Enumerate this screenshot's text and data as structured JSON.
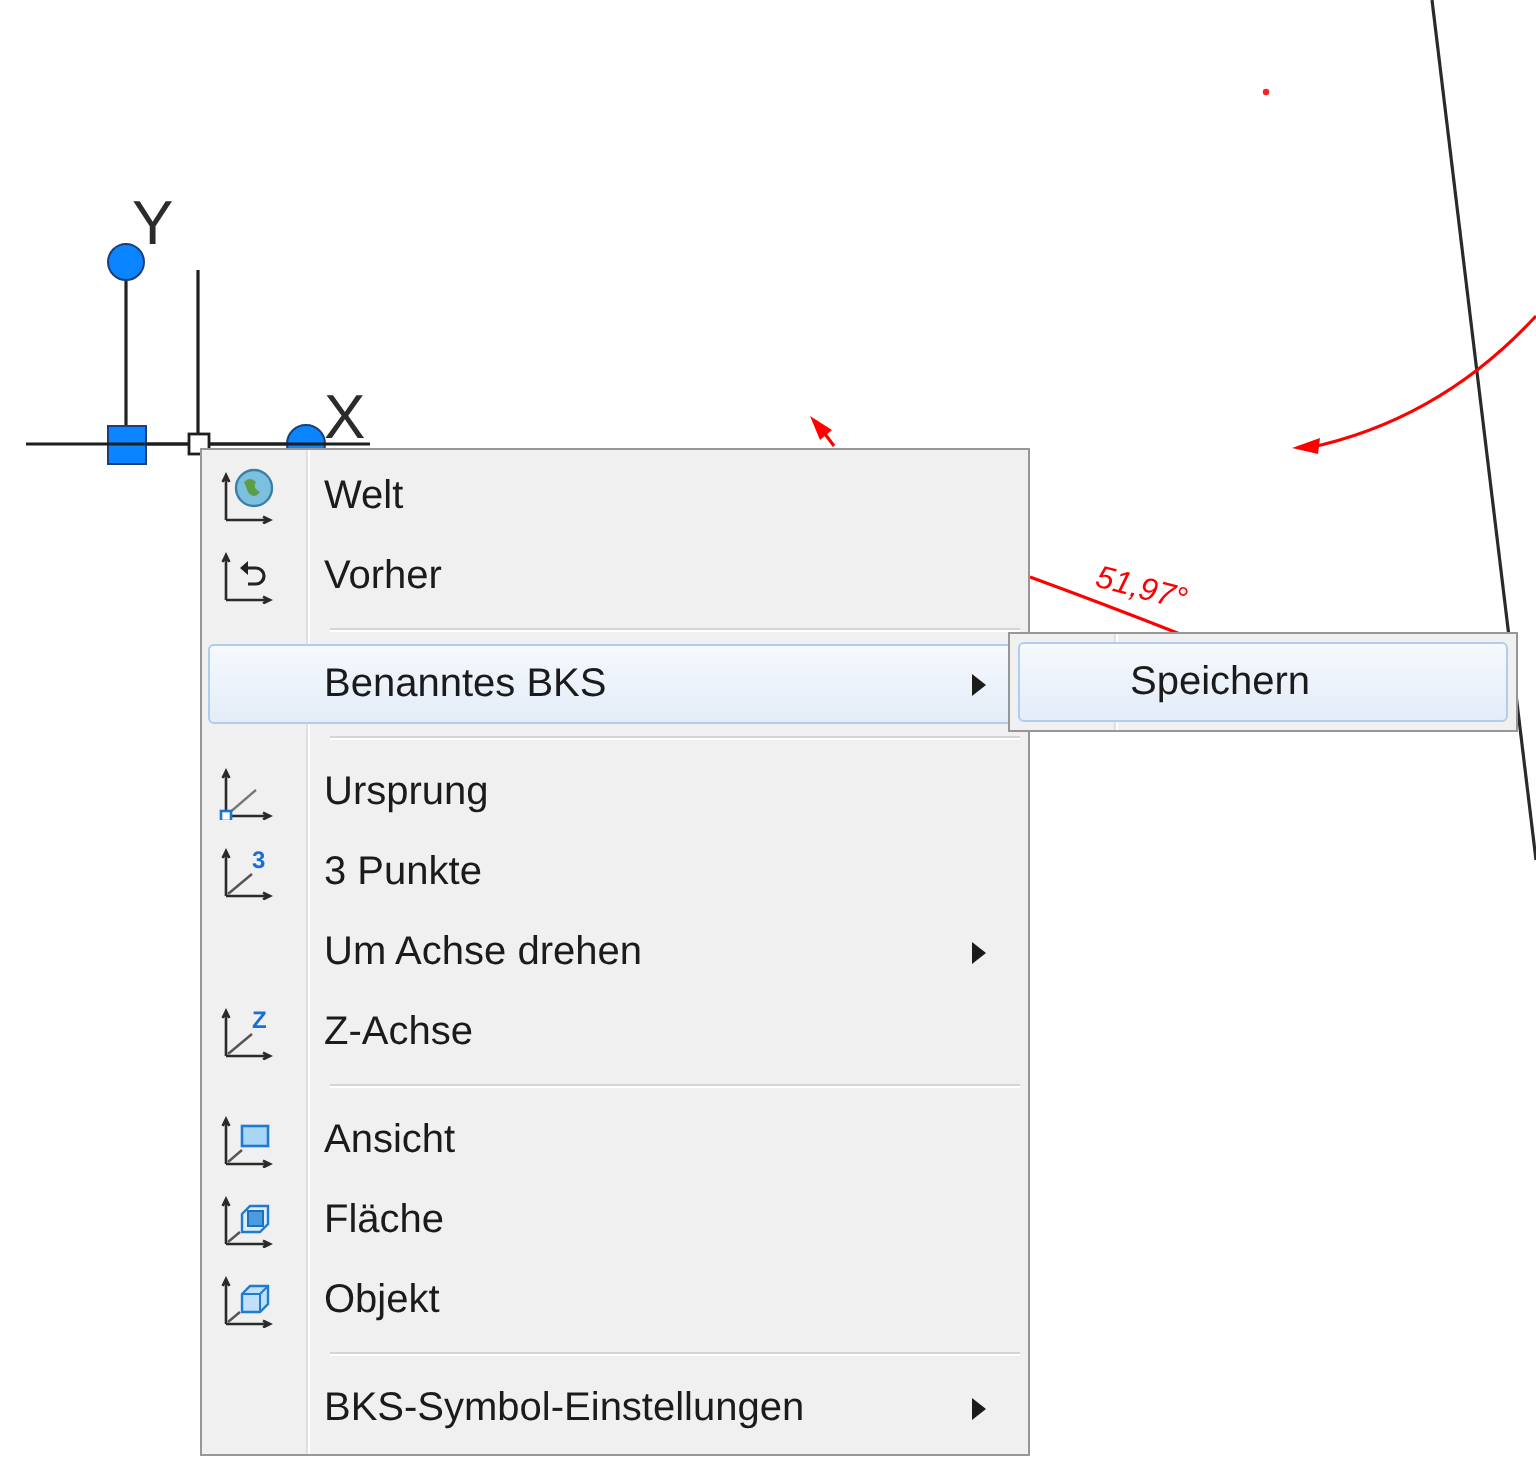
{
  "drawing": {
    "ucs_icon": {
      "y_label": "Y",
      "x_label": "X"
    },
    "dimension": {
      "text": "51,97°"
    }
  },
  "context_menu": {
    "entries": [
      {
        "kind": "command",
        "label": "Welt",
        "selected": false
      },
      {
        "kind": "command",
        "label": "Vorher",
        "selected": false
      },
      {
        "kind": "separator"
      },
      {
        "kind": "submenu",
        "label": "Benanntes BKS",
        "selected": true
      },
      {
        "kind": "separator"
      },
      {
        "kind": "command",
        "label": "Ursprung",
        "selected": false
      },
      {
        "kind": "command",
        "label": "3 Punkte",
        "icon_text": "3",
        "selected": false
      },
      {
        "kind": "submenu",
        "label": "Um Achse drehen",
        "selected": false
      },
      {
        "kind": "command",
        "label": "Z-Achse",
        "icon_text": "Z",
        "selected": false
      },
      {
        "kind": "separator"
      },
      {
        "kind": "command",
        "label": "Ansicht",
        "selected": false
      },
      {
        "kind": "command",
        "label": "Fläche",
        "selected": false
      },
      {
        "kind": "command",
        "label": "Objekt",
        "selected": false
      },
      {
        "kind": "separator"
      },
      {
        "kind": "submenu",
        "label": "BKS-Symbol-Einstellungen",
        "selected": false
      }
    ]
  },
  "submenu": {
    "entries": [
      {
        "kind": "command",
        "label": "Speichern",
        "selected": true
      }
    ]
  }
}
